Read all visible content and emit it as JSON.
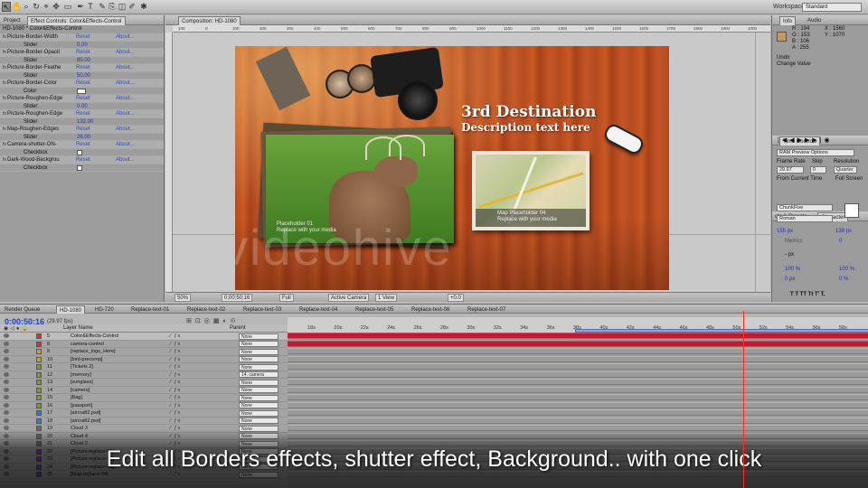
{
  "toolbar": {
    "workspace_label": "Workspace:",
    "workspace_value": "Standard"
  },
  "left_panel": {
    "tabs": [
      "Project",
      "Effect Controls: Color&Effects-Control"
    ],
    "header": "HD-1080 * Color&Effects-Control",
    "reset_label": "Reset",
    "about_label": "About...",
    "rows": [
      {
        "kind": "effect",
        "name": "Picture-Border-Width"
      },
      {
        "kind": "param",
        "name": "Slider",
        "value": "0.00"
      },
      {
        "kind": "effect",
        "name": "Picture-Border-Opacit"
      },
      {
        "kind": "param",
        "name": "Slider",
        "value": "85.00"
      },
      {
        "kind": "effect",
        "name": "Picture-Border-Feathe"
      },
      {
        "kind": "param",
        "name": "Slider",
        "value": "50.00"
      },
      {
        "kind": "effect",
        "name": "Picture-Border-Color"
      },
      {
        "kind": "color",
        "name": "Color"
      },
      {
        "kind": "effect",
        "name": "Picture-Roughen-Edge"
      },
      {
        "kind": "param",
        "name": "Slider",
        "value": "0.00"
      },
      {
        "kind": "effect",
        "name": "Picture-Roughen-Edge"
      },
      {
        "kind": "param",
        "name": "Slider",
        "value": "132.00"
      },
      {
        "kind": "effect",
        "name": "Map-Roughen-Edges"
      },
      {
        "kind": "param",
        "name": "Slider",
        "value": "26.00"
      },
      {
        "kind": "effect",
        "name": "Camera-shutter-ON-"
      },
      {
        "kind": "check",
        "name": "Checkbox"
      },
      {
        "kind": "effect",
        "name": "Dark-Wood-Backgrou"
      },
      {
        "kind": "check",
        "name": "Checkbox"
      }
    ]
  },
  "comp": {
    "tab": "Composition: HD-1080",
    "headline": "3rd Destination",
    "subline": "Description text here",
    "deer_caption": [
      "Placeholder 01",
      "Replace with your media"
    ],
    "map_caption": [
      "Map Placeholder 04",
      "Replace with your media"
    ],
    "watermark": "videohive",
    "ruler_ticks": [
      "100",
      "0",
      "100",
      "200",
      "300",
      "400",
      "500",
      "600",
      "700",
      "800",
      "900",
      "1000",
      "1100",
      "1200",
      "1300",
      "1400",
      "1500",
      "1600",
      "1700",
      "1800",
      "1900",
      "2000"
    ],
    "bottom": {
      "zoom": "50%",
      "timecode": "0;00;50;16",
      "resolution": "Full",
      "camera": "Active Camera",
      "view": "1 View",
      "exposure": "+0.0"
    }
  },
  "info": {
    "tabs": [
      "Info",
      "Audio"
    ],
    "r": "R : 194",
    "g": "G : 153",
    "b": "B : 106",
    "a": "A : 255",
    "x": "X : 1560",
    "y": "Y : 1070",
    "undo": "Undo",
    "undo_action": "Change Value",
    "color": "#c29a6a"
  },
  "time_controls": {
    "title": "Time Controls",
    "ram": "RAM Preview Options",
    "frame_rate_label": "Frame Rate",
    "skip_label": "Skip",
    "resolution_label": "Resolution",
    "frame_rate": "29.97",
    "skip": "0",
    "resolution": "Quarter",
    "from_current": "From Current Time",
    "full_screen": "Full Screen"
  },
  "character": {
    "tabs": [
      "cts & Presets",
      "Character"
    ],
    "font": "ChunkFive",
    "style": "Roman",
    "size": "155 px",
    "leading": "138 px",
    "tracking": "Metrics",
    "kerning": "0",
    "indent": "- px",
    "vscale": "100 %",
    "hscale": "100 %",
    "baseline": "0 px",
    "tsume": "0 %",
    "styles": "T T TT Tt T' T,"
  },
  "timeline": {
    "tabs": [
      "Render Queue",
      "HD-1080",
      "HD-720",
      "Replace-text-01",
      "Replace-text-02",
      "Replace-text-03",
      "Replace-text-04",
      "Replace-text-05",
      "Replace-text-06",
      "Replace-text-07"
    ],
    "timecode": "0;00;50;16",
    "fps": "(29.97 fps)",
    "col_name": "Layer Name",
    "col_parent": "Parent",
    "ticks": [
      "18s",
      "20s",
      "22s",
      "24s",
      "26s",
      "28s",
      "30s",
      "32s",
      "34s",
      "36s",
      "38s",
      "40s",
      "42s",
      "44s",
      "46s",
      "48s",
      "50s",
      "52s",
      "54s",
      "56s",
      "58s"
    ],
    "layers": [
      {
        "n": "5",
        "name": "Color&Effects-Control",
        "parent": "None",
        "sel": true,
        "red": true,
        "color": "#c83a3a"
      },
      {
        "n": "8",
        "name": "camera-control",
        "parent": "None",
        "red": true,
        "color": "#c83a3a"
      },
      {
        "n": "9",
        "name": "[replace_logo_Here]",
        "parent": "None",
        "color": "#c8a23a"
      },
      {
        "n": "10",
        "name": "[bird-precomp]",
        "parent": "None",
        "color": "#c8a23a"
      },
      {
        "n": "11",
        "name": "[Tickets 2]",
        "parent": "None",
        "color": "#7a9a3a"
      },
      {
        "n": "12",
        "name": "[memory]",
        "parent": "14. camera",
        "color": "#7a9a3a"
      },
      {
        "n": "13",
        "name": "[sunglass]",
        "parent": "None",
        "color": "#7a9a3a"
      },
      {
        "n": "14",
        "name": "[camera]",
        "parent": "None",
        "color": "#7a9a3a"
      },
      {
        "n": "15",
        "name": "[Bag]",
        "parent": "None",
        "color": "#7a9a3a"
      },
      {
        "n": "16",
        "name": "[passport]",
        "parent": "None",
        "color": "#7a9a3a"
      },
      {
        "n": "17",
        "name": "[aircraft2.psd]",
        "parent": "None",
        "color": "#3a7ac8"
      },
      {
        "n": "18",
        "name": "[aircraft2.psd]",
        "parent": "None",
        "color": "#3a7ac8"
      },
      {
        "n": "19",
        "name": "Cloud 3",
        "parent": "None",
        "color": "#6a6a6a"
      },
      {
        "n": "20",
        "name": "Cloud 4",
        "parent": "None",
        "color": "#6a6a6a"
      },
      {
        "n": "21",
        "name": "Cloud 2",
        "parent": "None",
        "color": "#6a6a6a"
      },
      {
        "n": "22",
        "name": "[Picture-replace-03]",
        "parent": "None",
        "color": "#8a3ac8"
      },
      {
        "n": "23",
        "name": "[Picture-replace-02]",
        "parent": "None",
        "color": "#8a3ac8"
      },
      {
        "n": "24",
        "name": "[Picture-replace-01]",
        "parent": "None",
        "color": "#8a3ac8"
      },
      {
        "n": "25",
        "name": "[Map-replace-04]",
        "parent": "None",
        "color": "#8a3ac8"
      }
    ]
  },
  "caption": "Edit all Borders effects, shutter effect, Background.. with one click"
}
